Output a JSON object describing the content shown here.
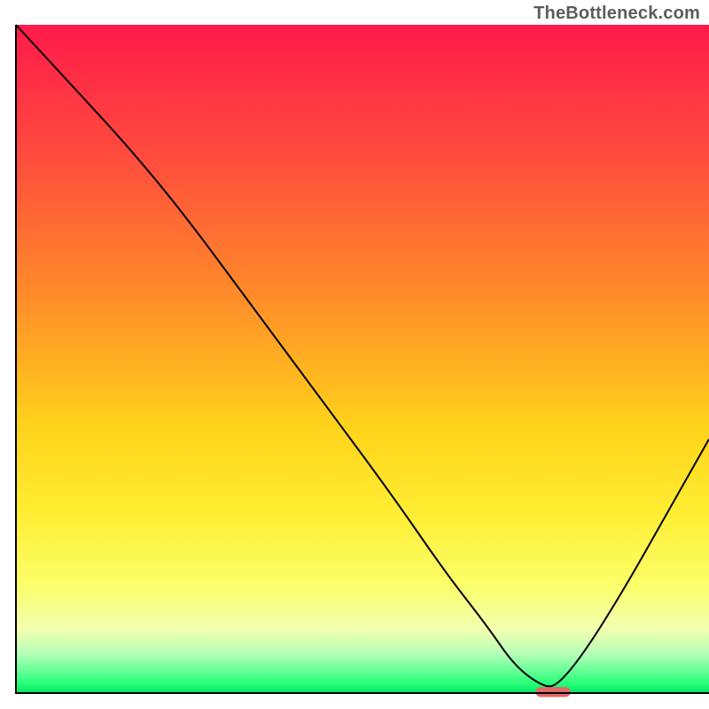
{
  "watermark": "TheBottleneck.com",
  "chart_data": {
    "type": "line",
    "title": "",
    "xlabel": "",
    "ylabel": "",
    "xlim": [
      0,
      100
    ],
    "ylim": [
      0,
      100
    ],
    "gradient_stops": [
      {
        "offset": 0.0,
        "color": "#ff1a4b"
      },
      {
        "offset": 0.2,
        "color": "#ff4d3d"
      },
      {
        "offset": 0.4,
        "color": "#ff8a2a"
      },
      {
        "offset": 0.6,
        "color": "#ffd21a"
      },
      {
        "offset": 0.73,
        "color": "#ffee33"
      },
      {
        "offset": 0.84,
        "color": "#fbff6b"
      },
      {
        "offset": 0.905,
        "color": "#f2ffb0"
      },
      {
        "offset": 0.94,
        "color": "#b8ffb8"
      },
      {
        "offset": 0.965,
        "color": "#6cff9a"
      },
      {
        "offset": 0.985,
        "color": "#2aff7a"
      },
      {
        "offset": 1.0,
        "color": "#00e565"
      }
    ],
    "series": [
      {
        "name": "bottleneck-curve",
        "x": [
          0,
          8,
          16,
          24,
          34,
          44,
          54,
          62,
          68,
          72,
          76,
          78,
          82,
          88,
          94,
          100
        ],
        "y": [
          100,
          91,
          82,
          72,
          58,
          44,
          30,
          18,
          10,
          4,
          1,
          1,
          6,
          16,
          27,
          38
        ]
      }
    ],
    "marker": {
      "x": 77.5,
      "y": 0,
      "width_pct": 5,
      "height_pct": 1.5,
      "color": "#e06a6a"
    },
    "axis_color": "#000000",
    "curve_color": "#000000",
    "curve_width": 2
  }
}
